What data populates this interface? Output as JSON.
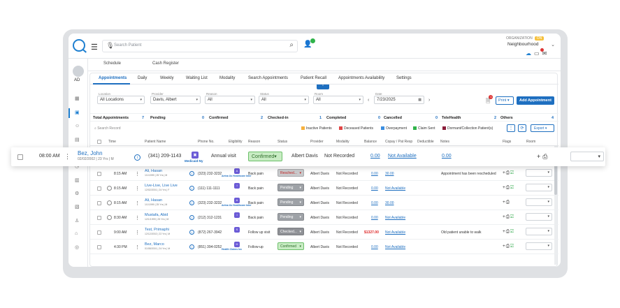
{
  "topbar": {
    "search_placeholder": "Search Patient",
    "org_label": "ORGANIZATION",
    "org_chip": "ON",
    "org_name": "Neighbourhood",
    "avatar_label": "AD"
  },
  "subtabs": [
    "Schedule",
    "Cash Register"
  ],
  "tabs": [
    "Appointments",
    "Daily",
    "Weekly",
    "Waiting List",
    "Modality",
    "Search Appointments",
    "Patient Recall",
    "Appointments Availability",
    "Settings"
  ],
  "filters": [
    {
      "label": "Location",
      "value": "All Locations"
    },
    {
      "label": "Provider",
      "value": "Davis, Albert"
    },
    {
      "label": "Reason",
      "value": "All"
    },
    {
      "label": "Status",
      "value": "All"
    },
    {
      "label": "Room",
      "value": "All"
    },
    {
      "label": "Date",
      "value": "7/23/2025"
    }
  ],
  "actions": {
    "print": "Print",
    "add": "Add Appointment",
    "export": "Export",
    "doc_count": "1"
  },
  "summary": [
    {
      "label": "Total Appointments",
      "value": "7"
    },
    {
      "label": "Pending",
      "value": "0"
    },
    {
      "label": "Confirmed",
      "value": "2"
    },
    {
      "label": "Checked-in",
      "value": "1"
    },
    {
      "label": "Completed",
      "value": "0"
    },
    {
      "label": "Cancelled",
      "value": "0"
    },
    {
      "label": "TeleHealth",
      "value": "2"
    },
    {
      "label": "Others",
      "value": "4"
    }
  ],
  "legend": {
    "search_placeholder": "Search Record",
    "items": [
      {
        "label": "Inactive Patients",
        "color": "#f6b13d"
      },
      {
        "label": "Deceased Patients",
        "color": "#e04646"
      },
      {
        "label": "Overpayment",
        "color": "#3a8de0"
      },
      {
        "label": "Claim Sent",
        "color": "#2fb34a"
      },
      {
        "label": "Dormant/Collection Patient(s)",
        "color": "#8a1e3a"
      }
    ]
  },
  "columns": [
    "Time",
    "Patient Name",
    "Phone No.",
    "Eligibility",
    "Reason",
    "Status",
    "Provider",
    "Modality",
    "Balance",
    "Copay / Pat Resp",
    "Deductible",
    "Notes",
    "Flags",
    "Room"
  ],
  "highlight_row": {
    "time": "08:00 AM",
    "name": "Bez, John",
    "dob": "02/02/2002 | 23 Yrs | M",
    "phone": "(341) 209-1143",
    "eligibility": "Medicaid-Ny",
    "reason": "Annual visit",
    "status": "Confirmed",
    "provider": "Albert Davis",
    "modality": "Not Recorded",
    "balance": "0.00",
    "copay": "Not Available",
    "deductible": "0.00"
  },
  "rows": [
    {
      "time": "8:15 AM",
      "name": "Ali, Hasan",
      "dob": "1/1/1999 | 25 Yrs | M",
      "phone": "(323) 232-3232",
      "elig_badge": "A",
      "elig": "Aetna Us Healthcare Inter",
      "reason": "Back pain",
      "status": "Resched...",
      "status_kind": "resched",
      "provider": "Albert Davis",
      "modality": "Not Recorded",
      "balance": "0.00",
      "copay": "30.00",
      "notes": "Appointment has been rescheduled"
    },
    {
      "time": "8:15 AM",
      "name": "Live-Live, Live Live",
      "dob": "12/02/2001 | 24 Yrs | F",
      "phone": "(111) 111-1111",
      "elig_badge": "I",
      "elig": "",
      "reason": "Back pain",
      "status": "Pending",
      "status_kind": "pending",
      "provider": "Albert Davis",
      "modality": "Not Recorded",
      "balance": "0.00",
      "copay": "Not Available",
      "notes": ""
    },
    {
      "time": "8:15 AM",
      "name": "Ali, Hasan",
      "dob": "1/1/1999 | 25 Yrs | M",
      "phone": "(323) 232-3232",
      "elig_badge": "A",
      "elig": "Aetna Us Healthcare Inter",
      "reason": "Back pain",
      "status": "Pending",
      "status_kind": "pending",
      "provider": "Albert Davis",
      "modality": "Not Recorded",
      "balance": "0.00",
      "copay": "30.00",
      "notes": ""
    },
    {
      "time": "8:30 AM",
      "name": "Mustafa, Abid",
      "dob": "12/1/1999 | 25 Yrs | M",
      "phone": "(212) 312-1231",
      "elig_badge": "I",
      "elig": "",
      "reason": "Back pain",
      "status": "Pending",
      "status_kind": "pending",
      "provider": "Albert Davis",
      "modality": "Not Recorded",
      "balance": "0.00",
      "copay": "Not Available",
      "notes": ""
    },
    {
      "time": "9:00 AM",
      "name": "Test, Primaphi",
      "dob": "12/12/2002 | 22 Yrs | M",
      "phone": "(872) 267-3942",
      "elig_badge": "S",
      "elig": "",
      "reason": "Follow up visit",
      "status": "Checked...",
      "status_kind": "checked",
      "provider": "Albert Davis",
      "modality": "Not Recorded",
      "balance": "$1327.00",
      "copay": "Not Available",
      "notes": "Old patient unable to walk"
    },
    {
      "time": "4:30 PM",
      "name": "Bez, Marco",
      "dob": "01/08/2001 | 24 Yrs | M",
      "phone": "(851) 394-0252",
      "elig_badge": "H",
      "elig": "Health Claims Inc",
      "reason": "Follow-up",
      "status": "Confirmed",
      "status_kind": "confirmed",
      "provider": "Albert Davis",
      "modality": "Not Recorded",
      "balance": "0.00",
      "copay": "Not Available",
      "notes": ""
    }
  ],
  "colors": {
    "accent": "#1e6fc0",
    "confirmed_bg": "#c9ecc4",
    "pending_bg": "#9a9ea3",
    "resched_bg": "#b8b9bb",
    "checked_bg": "#8d8f93"
  }
}
